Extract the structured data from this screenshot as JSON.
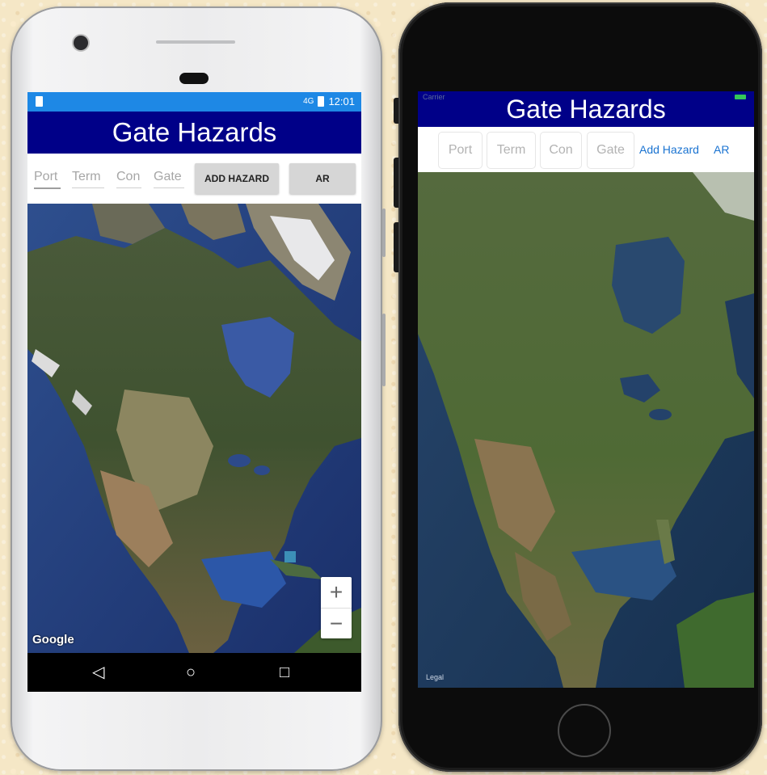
{
  "android": {
    "status_time": "12:01",
    "status_signal": "4G",
    "title": "Gate Hazards",
    "fields": [
      {
        "placeholder": "Port"
      },
      {
        "placeholder": "Term"
      },
      {
        "placeholder": "Con"
      },
      {
        "placeholder": "Gate"
      }
    ],
    "add_hazard_label": "ADD HAZARD",
    "ar_label": "AR",
    "zoom_in": "+",
    "zoom_out": "−",
    "map_attribution": "Google",
    "nav": {
      "back": "◁",
      "home": "○",
      "recents": "□"
    }
  },
  "ios": {
    "carrier": "Carrier",
    "title": "Gate Hazards",
    "fields": [
      {
        "placeholder": "Port"
      },
      {
        "placeholder": "Term"
      },
      {
        "placeholder": "Con"
      },
      {
        "placeholder": "Gate"
      }
    ],
    "add_hazard_label": "Add Hazard",
    "ar_label": "AR",
    "map_attribution": "Legal"
  },
  "colors": {
    "title_bar": "#000088",
    "android_status": "#1e88e5",
    "ios_link": "#1a73d1"
  }
}
